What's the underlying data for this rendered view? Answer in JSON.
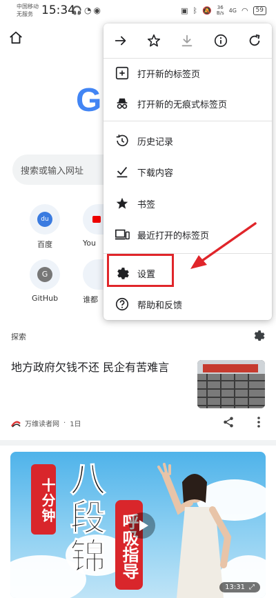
{
  "status_bar": {
    "carrier_line1": "中国移动",
    "carrier_line2": "无服务",
    "time": "15:34",
    "net_speed_value": "36",
    "net_speed_unit": "B/s",
    "signal": "4G",
    "battery": "59"
  },
  "ntp": {
    "logo_text": "G",
    "search_placeholder": "搜索或输入网址",
    "shortcuts": [
      {
        "label": "百度",
        "badge": "du"
      },
      {
        "label": "You",
        "badge": ""
      },
      {
        "label": "GitHub",
        "badge": "G"
      },
      {
        "label": "谁都",
        "badge": ""
      }
    ]
  },
  "feed": {
    "section_label": "探索",
    "article": {
      "title": "地方政府欠钱不还 民企有苦难言",
      "source": "万维读者网",
      "time": "1日"
    },
    "video": {
      "tag1": "十分钟",
      "big_text": "八段锦",
      "tag2": "呼吸指导",
      "duration": "13:31"
    }
  },
  "menu": {
    "toolbar": [
      "forward-icon",
      "star-icon",
      "download-icon",
      "info-icon",
      "refresh-icon"
    ],
    "items": [
      {
        "label": "打开新的标签页",
        "icon": "new-tab-icon"
      },
      {
        "label": "打开新的无痕式标签页",
        "icon": "incognito-icon"
      },
      {
        "label": "历史记录",
        "icon": "history-icon"
      },
      {
        "label": "下载内容",
        "icon": "downloads-icon"
      },
      {
        "label": "书签",
        "icon": "bookmark-star-icon"
      },
      {
        "label": "最近打开的标签页",
        "icon": "recent-tabs-icon"
      },
      {
        "label": "设置",
        "icon": "settings-gear-icon"
      },
      {
        "label": "帮助和反馈",
        "icon": "help-icon"
      }
    ]
  },
  "annotation": {
    "highlight_color": "#e0252a"
  }
}
